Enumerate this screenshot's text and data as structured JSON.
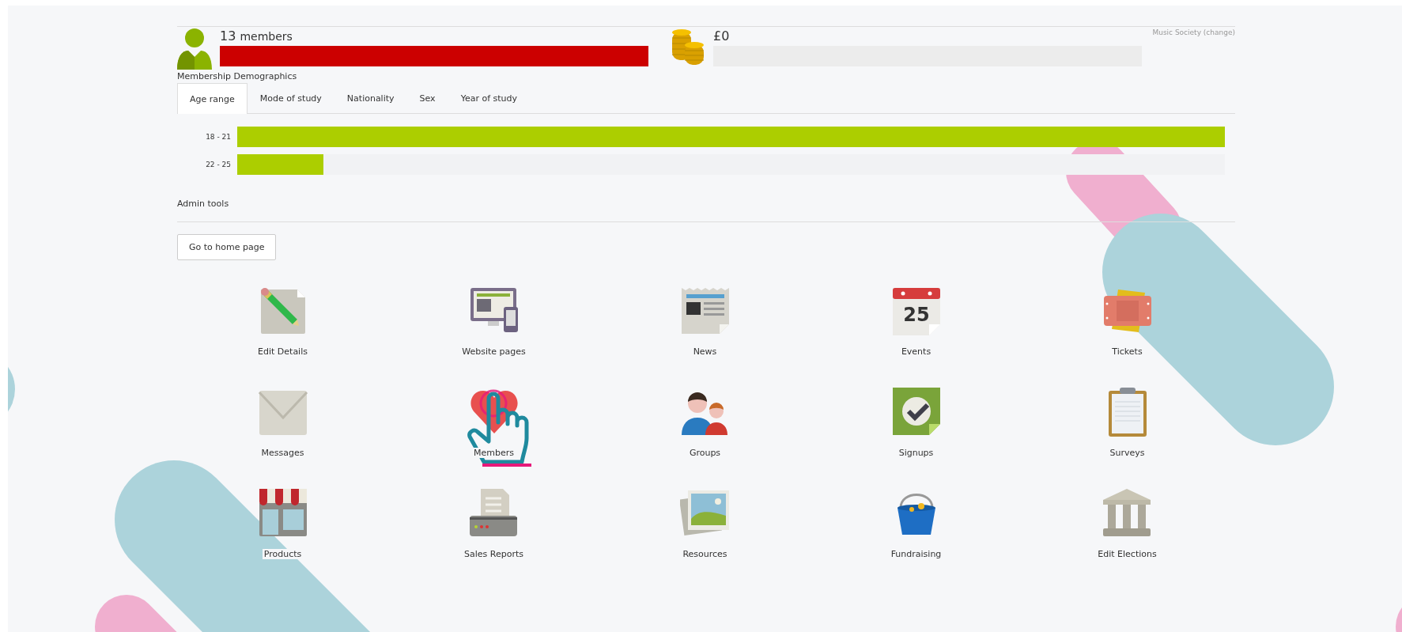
{
  "summary": {
    "members": {
      "count": "13",
      "unit": "members",
      "level": 1
    },
    "funds": {
      "amount": "£0",
      "level": 0
    },
    "society": {
      "name": "Music Society",
      "link": "(change)"
    }
  },
  "demographics": {
    "title": "Membership Demographics",
    "tabs": [
      {
        "label": "Age range",
        "selected": true
      },
      {
        "label": "Mode of study",
        "selected": false
      },
      {
        "label": "Nationality",
        "selected": false
      },
      {
        "label": "Sex",
        "selected": false
      },
      {
        "label": "Year of study",
        "selected": false
      }
    ],
    "rows": [
      {
        "label": "18 - 21",
        "level": 1
      },
      {
        "label": "22 - 25",
        "level": 0.087
      }
    ]
  },
  "admin": {
    "title": "Admin tools",
    "button": "Go to home page",
    "tools": [
      {
        "label": "Edit Details"
      },
      {
        "label": "Website pages"
      },
      {
        "label": "News"
      },
      {
        "label": "Events",
        "icon_text": "25"
      },
      {
        "label": "Tickets"
      },
      {
        "label": "Messages"
      },
      {
        "label": "Members"
      },
      {
        "label": "Groups"
      },
      {
        "label": "Signups"
      },
      {
        "label": "Surveys"
      },
      {
        "label": "Products"
      },
      {
        "label": "Sales Reports"
      },
      {
        "label": "Resources"
      },
      {
        "label": "Fundraising"
      },
      {
        "label": "Edit Elections"
      }
    ]
  }
}
